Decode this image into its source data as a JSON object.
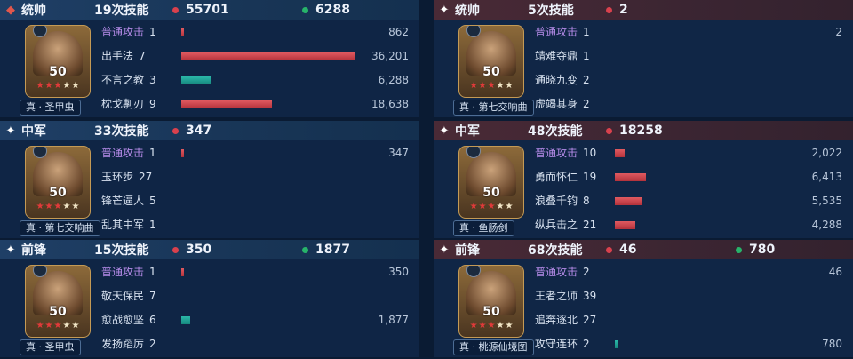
{
  "colors": {
    "damage": "#d9414d",
    "heal": "#27b36a",
    "basic_attack": "#b58be8"
  },
  "left": [
    {
      "role": "统帅",
      "role_icon": "commander-emblem-icon",
      "casts": "19次技能",
      "damage": "55701",
      "heal": "6288",
      "level": "50",
      "stars": "5",
      "equipment": "真 · 圣甲虫",
      "skills": [
        {
          "name": "普通攻击",
          "count": "1",
          "value": "862",
          "dmg_pct": 1.6,
          "basic": true
        },
        {
          "name": "出手法",
          "count": "7",
          "value": "36,201",
          "dmg_pct": 100
        },
        {
          "name": "不言之教",
          "count": "3",
          "value": "6,288",
          "heal_pct": 17
        },
        {
          "name": "枕戈剸刃",
          "count": "9",
          "value": "18,638",
          "dmg_pct": 52
        }
      ]
    },
    {
      "role": "中军",
      "role_icon": "sparkle-icon",
      "casts": "33次技能",
      "damage": "347",
      "level": "50",
      "stars": "5",
      "equipment": "真 · 第七交响曲",
      "skills": [
        {
          "name": "普通攻击",
          "count": "1",
          "value": "347",
          "dmg_pct": 0.8,
          "basic": true
        },
        {
          "name": "玉环步",
          "count": "27",
          "value": ""
        },
        {
          "name": "锋芒逼人",
          "count": "5",
          "value": ""
        },
        {
          "name": "乱其中军",
          "count": "1",
          "value": ""
        }
      ]
    },
    {
      "role": "前锋",
      "role_icon": "sparkle-icon",
      "casts": "15次技能",
      "damage": "350",
      "heal": "1877",
      "level": "50",
      "stars": "5",
      "equipment": "真 · 圣甲虫",
      "skills": [
        {
          "name": "普通攻击",
          "count": "1",
          "value": "350",
          "dmg_pct": 0.8,
          "basic": true
        },
        {
          "name": "敬天保民",
          "count": "7",
          "value": ""
        },
        {
          "name": "愈战愈坚",
          "count": "6",
          "value": "1,877",
          "heal_pct": 5
        },
        {
          "name": "发扬蹈厉",
          "count": "2",
          "value": ""
        }
      ]
    }
  ],
  "right": [
    {
      "role": "统帅",
      "role_icon": "sparkle-icon",
      "casts": "5次技能",
      "damage": "2",
      "level": "50",
      "stars": "5",
      "equipment": "真 · 第七交响曲",
      "skills": [
        {
          "name": "普通攻击",
          "count": "1",
          "value": "2",
          "basic": true
        },
        {
          "name": "靖难夺鼎",
          "count": "1",
          "value": ""
        },
        {
          "name": "通晓九变",
          "count": "2",
          "value": ""
        },
        {
          "name": "虚竭其身",
          "count": "2",
          "value": ""
        }
      ]
    },
    {
      "role": "中军",
      "role_icon": "sparkle-icon",
      "casts": "48次技能",
      "damage": "18258",
      "level": "50",
      "stars": "5",
      "equipment": "真 · 鱼肠剑",
      "skills": [
        {
          "name": "普通攻击",
          "count": "10",
          "value": "2,022",
          "dmg_pct": 5.6,
          "basic": true
        },
        {
          "name": "勇而怀仁",
          "count": "19",
          "value": "6,413",
          "dmg_pct": 17.7
        },
        {
          "name": "浪叠千钧",
          "count": "8",
          "value": "5,535",
          "dmg_pct": 15.3
        },
        {
          "name": "纵兵击之",
          "count": "21",
          "value": "4,288",
          "dmg_pct": 11.8
        }
      ]
    },
    {
      "role": "前锋",
      "role_icon": "sparkle-icon",
      "casts": "68次技能",
      "damage": "46",
      "heal": "780",
      "level": "50",
      "stars": "5",
      "equipment": "真 · 桃源仙境图",
      "skills": [
        {
          "name": "普通攻击",
          "count": "2",
          "value": "46",
          "basic": true
        },
        {
          "name": "王者之师",
          "count": "39",
          "value": ""
        },
        {
          "name": "追奔逐北",
          "count": "27",
          "value": ""
        },
        {
          "name": "攻守连环",
          "count": "2",
          "value": "780",
          "heal_pct": 2.2
        }
      ]
    }
  ]
}
